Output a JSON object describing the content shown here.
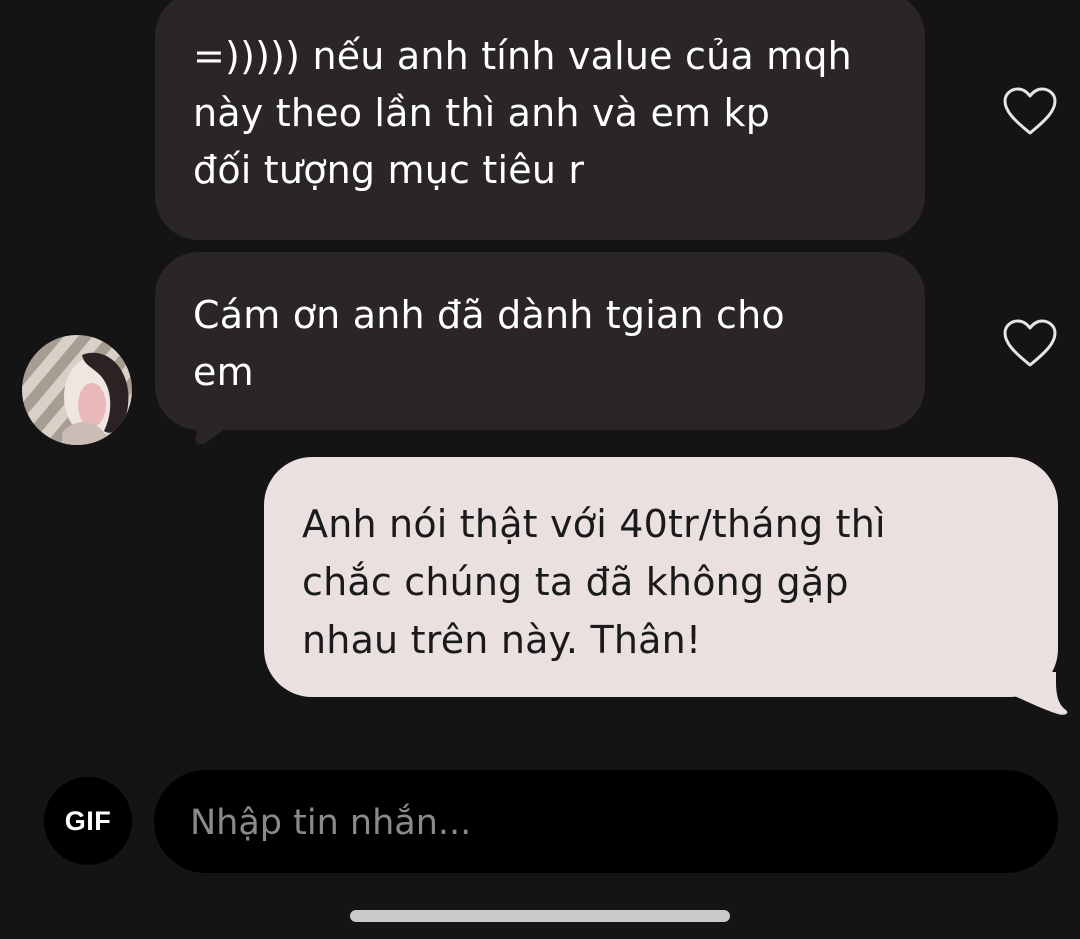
{
  "messages": [
    {
      "direction": "incoming",
      "lines": [
        "=))))) nếu anh tính value của mqh",
        "này theo lần thì anh và em kp",
        "đối tượng mục tiêu r"
      ],
      "reaction_icon": "heart-outline-icon"
    },
    {
      "direction": "incoming",
      "lines": [
        "Cám ơn anh đã dành tgian cho",
        "em"
      ],
      "reaction_icon": "heart-outline-icon"
    },
    {
      "direction": "outgoing",
      "lines": [
        "Anh nói thật với 40tr/tháng thì",
        "chắc chúng ta đã không gặp",
        "nhau trên này. Thân!"
      ]
    }
  ],
  "composer": {
    "gif_label": "GIF",
    "placeholder": "Nhập tin nhắn..."
  },
  "colors": {
    "background": "#141414",
    "incoming_bubble": "#2a2625",
    "outgoing_bubble": "#e9e0df",
    "input_background": "#000000"
  }
}
